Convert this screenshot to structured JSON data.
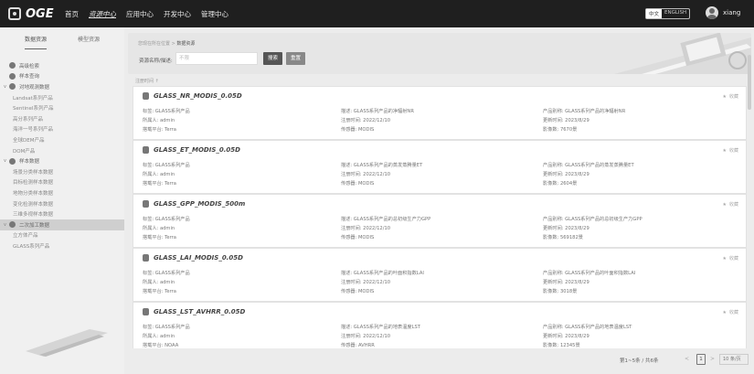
{
  "topbar": {
    "logo": "OGE",
    "nav": [
      "首页",
      "资源中心",
      "应用中心",
      "开发中心",
      "管理中心"
    ],
    "lang_zh": "中文",
    "lang_en": "ENGLISH",
    "user": "xiang"
  },
  "sidebar": {
    "tabs": [
      "数据资源",
      "模型资源"
    ],
    "items": [
      {
        "label": "高级检索",
        "level": 0,
        "chevron": ""
      },
      {
        "label": "样本查询",
        "level": 0,
        "chevron": ""
      },
      {
        "label": "对地观测数据",
        "level": 0,
        "chevron": "v"
      },
      {
        "label": "Landsat系列产品",
        "level": 1
      },
      {
        "label": "Sentinel系列产品",
        "level": 1
      },
      {
        "label": "高分系列产品",
        "level": 1
      },
      {
        "label": "海洋一号系列产品",
        "level": 1
      },
      {
        "label": "全球DEM产品",
        "level": 1
      },
      {
        "label": "DOM产品",
        "level": 1
      },
      {
        "label": "样本数据",
        "level": 0,
        "chevron": "v"
      },
      {
        "label": "场景分类样本数据",
        "level": 1
      },
      {
        "label": "目标检测样本数据",
        "level": 1
      },
      {
        "label": "地物分类样本数据",
        "level": 1
      },
      {
        "label": "变化检测样本数据",
        "level": 1
      },
      {
        "label": "三维多视样本数据",
        "level": 1
      },
      {
        "label": "二次加工数据",
        "level": 0,
        "chevron": "v",
        "selected": true
      },
      {
        "label": "立方体产品",
        "level": 1
      },
      {
        "label": "GLASS系列产品",
        "level": 1
      }
    ]
  },
  "header": {
    "breadcrumb_prefix": "您现在所在位置 > ",
    "breadcrumb_current": "数据资源",
    "search_label": "资源名称/描述:",
    "search_placeholder": "不限",
    "search_btn": "搜索",
    "reset_btn": "重置"
  },
  "sort_label": "注册时间 ↑",
  "cards": [
    {
      "title": "GLASS_NR_MODIS_0.05D",
      "tag": "标签: GLASS系列产品",
      "owner": "所属人: admin",
      "platform": "搭载平台: Terra",
      "desc": "描述: GLASS系列产品的净辐射NR",
      "reg": "注册时间: 2022/12/10",
      "sensor": "传感器: MODIS",
      "product": "产品别称: GLASS系列产品的净辐射NR",
      "updated": "更新时间: 2023/8/29",
      "count": "影像数: 7670景"
    },
    {
      "title": "GLASS_ET_MODIS_0.05D",
      "tag": "标签: GLASS系列产品",
      "owner": "所属人: admin",
      "platform": "搭载平台: Terra",
      "desc": "描述: GLASS系列产品的蒸发蒸腾量ET",
      "reg": "注册时间: 2022/12/10",
      "sensor": "传感器: MODIS",
      "product": "产品别称: GLASS系列产品的蒸发蒸腾量ET",
      "updated": "更新时间: 2023/8/29",
      "count": "影像数: 2604景"
    },
    {
      "title": "GLASS_GPP_MODIS_500m",
      "tag": "标签: GLASS系列产品",
      "owner": "所属人: admin",
      "platform": "搭载平台: Terra",
      "desc": "描述: GLASS系列产品的总初级生产力GPP",
      "reg": "注册时间: 2022/12/10",
      "sensor": "传感器: MODIS",
      "product": "产品别称: GLASS系列产品的总初级生产力GPP",
      "updated": "更新时间: 2023/8/29",
      "count": "影像数: 569182景"
    },
    {
      "title": "GLASS_LAI_MODIS_0.05D",
      "tag": "标签: GLASS系列产品",
      "owner": "所属人: admin",
      "platform": "搭载平台: Terra",
      "desc": "描述: GLASS系列产品的叶面积指数LAI",
      "reg": "注册时间: 2022/12/10",
      "sensor": "传感器: MODIS",
      "product": "产品别称: GLASS系列产品的叶面积指数LAI",
      "updated": "更新时间: 2023/8/29",
      "count": "影像数: 3018景"
    },
    {
      "title": "GLASS_LST_AVHRR_0.05D",
      "tag": "标签: GLASS系列产品",
      "owner": "所属人: admin",
      "platform": "搭载平台: NOAA",
      "desc": "描述: GLASS系列产品的地表温度LST",
      "reg": "注册时间: 2022/12/10",
      "sensor": "传感器: AVHRR",
      "product": "产品别称: GLASS系列产品的地表温度LST",
      "updated": "更新时间: 2023/8/29",
      "count": "影像数: 12345景"
    }
  ],
  "fav_label": "收藏",
  "pager": {
    "info": "第1~5条 / 共6条",
    "prev": "<",
    "page": "1",
    "next": ">",
    "size": "10 条/页"
  }
}
